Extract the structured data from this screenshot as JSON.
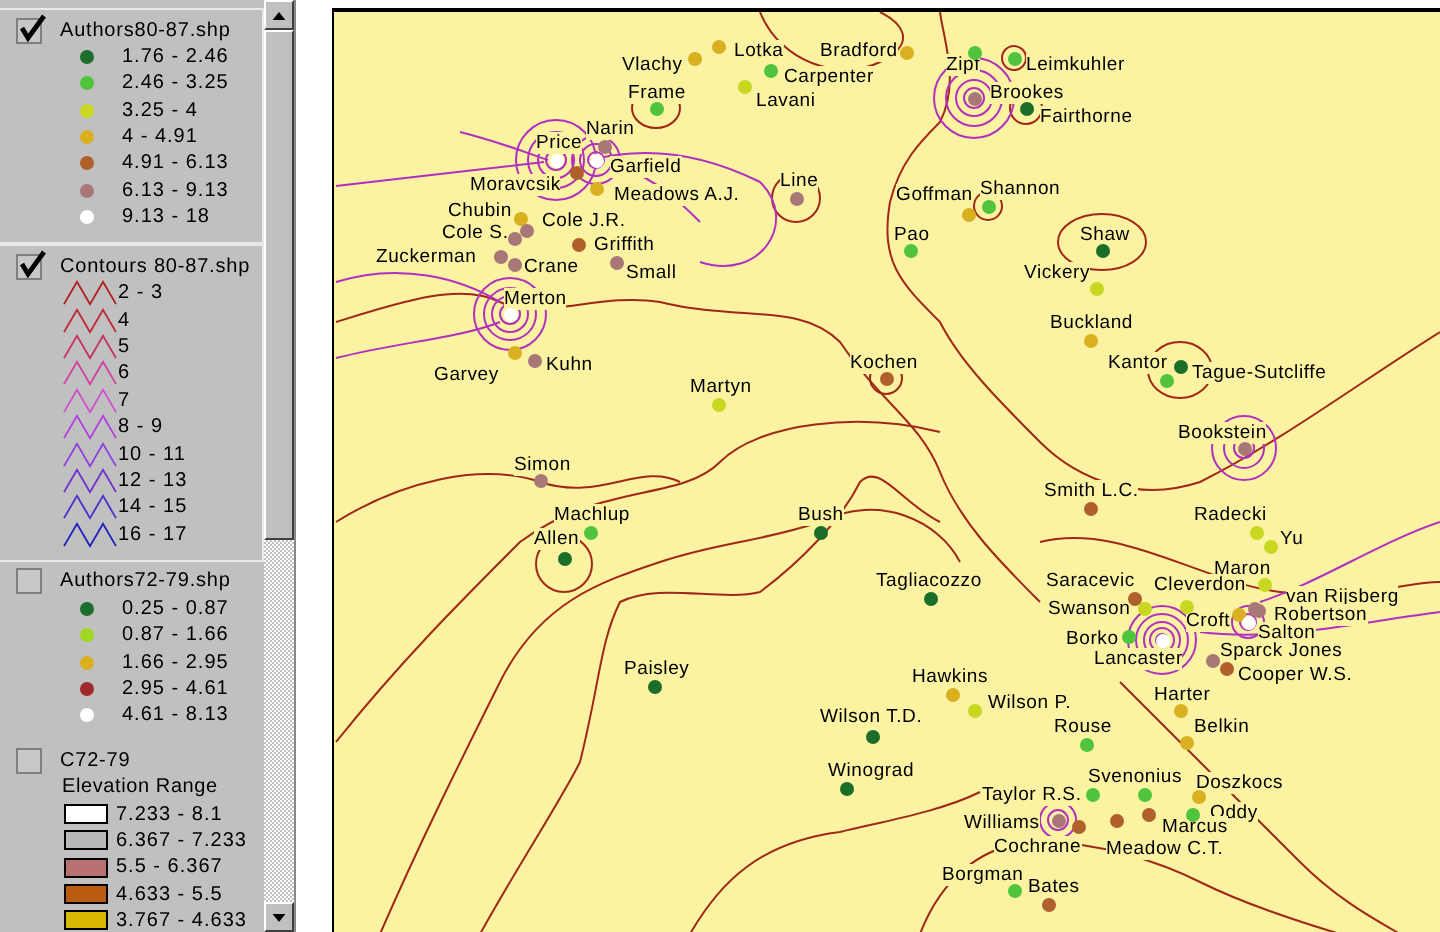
{
  "legend": {
    "layers": [
      {
        "kind": "points",
        "name": "Authors80-87.shp",
        "checked": true,
        "classes": [
          {
            "label": "1.76 - 2.46",
            "color": "#1a6e2a"
          },
          {
            "label": "2.46 - 3.25",
            "color": "#4fc43c"
          },
          {
            "label": "3.25 - 4",
            "color": "#c8d820"
          },
          {
            "label": "4 - 4.91",
            "color": "#d8b020"
          },
          {
            "label": "4.91 - 6.13",
            "color": "#b0602a"
          },
          {
            "label": "6.13 - 9.13",
            "color": "#a87878"
          },
          {
            "label": "9.13 - 18",
            "color": "#ffffff"
          }
        ]
      },
      {
        "kind": "lines",
        "name": "Contours 80-87.shp",
        "checked": true,
        "classes": [
          {
            "label": "2 - 3",
            "color": "#b02020"
          },
          {
            "label": "4",
            "color": "#c02838"
          },
          {
            "label": "5",
            "color": "#c83060"
          },
          {
            "label": "6",
            "color": "#d040a0"
          },
          {
            "label": "7",
            "color": "#d050d0"
          },
          {
            "label": "8 - 9",
            "color": "#b040e0"
          },
          {
            "label": "10 - 11",
            "color": "#9040e0"
          },
          {
            "label": "12 - 13",
            "color": "#7030d0"
          },
          {
            "label": "14 - 15",
            "color": "#5030d0"
          },
          {
            "label": "16 - 17",
            "color": "#2020c0"
          }
        ]
      },
      {
        "kind": "points",
        "name": "Authors72-79.shp",
        "checked": false,
        "classes": [
          {
            "label": "0.25 - 0.87",
            "color": "#1a6e2a"
          },
          {
            "label": "0.87 - 1.66",
            "color": "#a0d820"
          },
          {
            "label": "1.66 - 2.95",
            "color": "#d8b020"
          },
          {
            "label": "2.95 - 4.61",
            "color": "#a02828"
          },
          {
            "label": "4.61 - 8.13",
            "color": "#ffffff"
          }
        ]
      },
      {
        "kind": "fills",
        "name": "C72-79",
        "checked": false,
        "subtitle": "Elevation Range",
        "classes": [
          {
            "label": "7.233 - 8.1",
            "color": "#ffffff"
          },
          {
            "label": "6.367 - 7.233",
            "color": "#b8b8b8"
          },
          {
            "label": "5.5 - 6.367",
            "color": "#b87070"
          },
          {
            "label": "4.633 - 5.5",
            "color": "#b85a10"
          },
          {
            "label": "3.767 - 4.633",
            "color": "#d8b800"
          }
        ]
      }
    ]
  },
  "map": {
    "authors": [
      {
        "name": "Vlachy",
        "color": "#d8b020"
      },
      {
        "name": "Lotka",
        "color": "#d8b020"
      },
      {
        "name": "Bradford",
        "color": "#d8b020"
      },
      {
        "name": "Zipf",
        "color": "#4fc43c"
      },
      {
        "name": "Leimkuhler",
        "color": "#4fc43c"
      },
      {
        "name": "Carpenter",
        "color": "#4fc43c"
      },
      {
        "name": "Frame",
        "color": "#4fc43c"
      },
      {
        "name": "Lavani",
        "color": "#c8d820"
      },
      {
        "name": "Brookes",
        "color": "#a87878"
      },
      {
        "name": "Fairthorne",
        "color": "#1a6e2a"
      },
      {
        "name": "Narin",
        "color": "#a87878"
      },
      {
        "name": "Price",
        "color": "#ffffff"
      },
      {
        "name": "Garfield",
        "color": "#ffffff"
      },
      {
        "name": "Moravcsik",
        "color": "#b0602a"
      },
      {
        "name": "Meadows A.J.",
        "color": "#d8b020"
      },
      {
        "name": "Line",
        "color": "#a87878"
      },
      {
        "name": "Shannon",
        "color": "#4fc43c"
      },
      {
        "name": "Goffman",
        "color": "#d8b020"
      },
      {
        "name": "Chubin",
        "color": "#d8b020"
      },
      {
        "name": "Cole J.R.",
        "color": "#a87878"
      },
      {
        "name": "Cole S.",
        "color": "#a87878"
      },
      {
        "name": "Pao",
        "color": "#4fc43c"
      },
      {
        "name": "Shaw",
        "color": "#1a6e2a"
      },
      {
        "name": "Griffith",
        "color": "#b0602a"
      },
      {
        "name": "Zuckerman",
        "color": "#a87878"
      },
      {
        "name": "Crane",
        "color": "#a87878"
      },
      {
        "name": "Small",
        "color": "#a87878"
      },
      {
        "name": "Vickery",
        "color": "#c8d820"
      },
      {
        "name": "Merton",
        "color": "#ffffff"
      },
      {
        "name": "Buckland",
        "color": "#d8b020"
      },
      {
        "name": "Kochen",
        "color": "#b0602a"
      },
      {
        "name": "Kantor",
        "color": "#4fc43c"
      },
      {
        "name": "Tague-Sutcliffe",
        "color": "#1a6e2a"
      },
      {
        "name": "Kuhn",
        "color": "#a87878"
      },
      {
        "name": "Garvey",
        "color": "#d8b020"
      },
      {
        "name": "Martyn",
        "color": "#c8d820"
      },
      {
        "name": "Bookstein",
        "color": "#a87878"
      },
      {
        "name": "Simon",
        "color": "#a87878"
      },
      {
        "name": "Smith L.C.",
        "color": "#b0602a"
      },
      {
        "name": "Machlup",
        "color": "#4fc43c"
      },
      {
        "name": "Bush",
        "color": "#1a6e2a"
      },
      {
        "name": "Radecki",
        "color": "#c8d820"
      },
      {
        "name": "Allen",
        "color": "#1a6e2a"
      },
      {
        "name": "Yu",
        "color": "#c8d820"
      },
      {
        "name": "Maron",
        "color": "#c8d820"
      },
      {
        "name": "Tagliacozzo",
        "color": "#1a6e2a"
      },
      {
        "name": "Saracevic",
        "color": "#b0602a"
      },
      {
        "name": "Cleverdon",
        "color": "#c8d820"
      },
      {
        "name": "van Rijsberg",
        "color": "#a87878"
      },
      {
        "name": "Swanson",
        "color": "#c8d820"
      },
      {
        "name": "Robertson",
        "color": "#a87878"
      },
      {
        "name": "Croft",
        "color": "#d8b020"
      },
      {
        "name": "Salton",
        "color": "#ffffff"
      },
      {
        "name": "Borko",
        "color": "#4fc43c"
      },
      {
        "name": "Lancaster",
        "color": "#ffffff"
      },
      {
        "name": "Sparck Jones",
        "color": "#a87878"
      },
      {
        "name": "Paisley",
        "color": "#1a6e2a"
      },
      {
        "name": "Hawkins",
        "color": "#d8b020"
      },
      {
        "name": "Cooper W.S.",
        "color": "#b0602a"
      },
      {
        "name": "Harter",
        "color": "#d8b020"
      },
      {
        "name": "Wilson P.",
        "color": "#c8d820"
      },
      {
        "name": "Wilson T.D.",
        "color": "#1a6e2a"
      },
      {
        "name": "Belkin",
        "color": "#d8b020"
      },
      {
        "name": "Rouse",
        "color": "#4fc43c"
      },
      {
        "name": "Svenonius",
        "color": "#4fc43c"
      },
      {
        "name": "Doszkocs",
        "color": "#d8b020"
      },
      {
        "name": "Winograd",
        "color": "#1a6e2a"
      },
      {
        "name": "Taylor R.S.",
        "color": "#4fc43c"
      },
      {
        "name": "Oddy",
        "color": "#4fc43c"
      },
      {
        "name": "Williams",
        "color": "#a87878"
      },
      {
        "name": "Marcus",
        "color": "#b0602a"
      },
      {
        "name": "Cochrane",
        "color": "#b0602a"
      },
      {
        "name": "Meadow C.T.",
        "color": "#b0602a"
      },
      {
        "name": "Borgman",
        "color": "#4fc43c"
      },
      {
        "name": "Bates",
        "color": "#b0602a"
      }
    ]
  }
}
